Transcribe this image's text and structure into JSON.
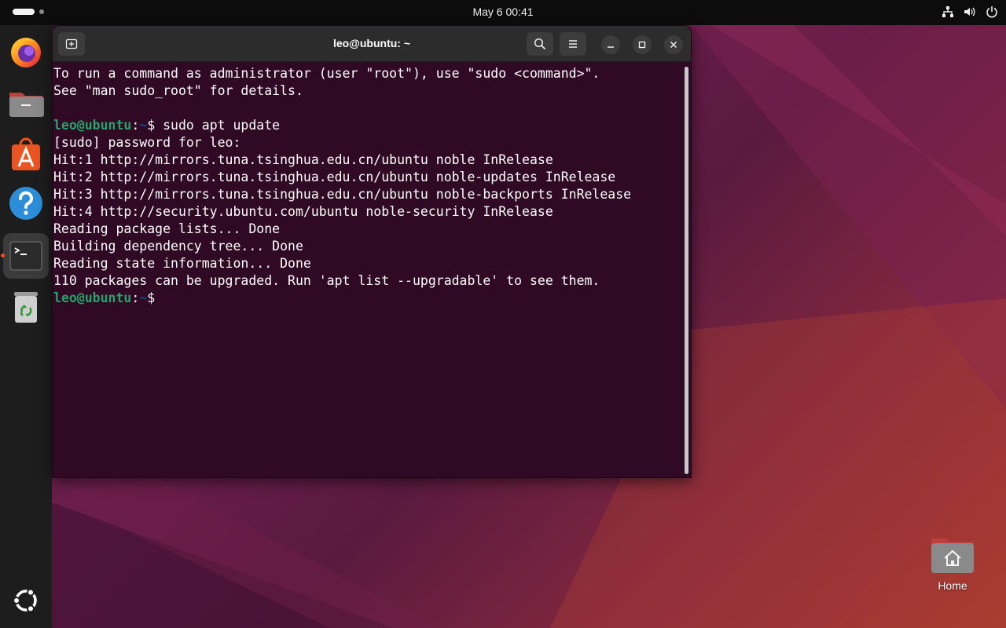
{
  "topbar": {
    "clock": "May 6  00:41",
    "tray_icons": [
      "network-icon",
      "volume-icon",
      "power-icon"
    ]
  },
  "dock": {
    "items": [
      {
        "name": "firefox",
        "icon": "firefox-icon"
      },
      {
        "name": "files",
        "icon": "folder-icon"
      },
      {
        "name": "app-center",
        "icon": "app-center-icon"
      },
      {
        "name": "help",
        "icon": "help-icon"
      },
      {
        "name": "terminal",
        "icon": "terminal-icon",
        "active": true
      },
      {
        "name": "trash",
        "icon": "trash-icon"
      },
      {
        "name": "show-apps",
        "icon": "ubuntu-logo-icon"
      }
    ]
  },
  "terminal": {
    "title": "leo@ubuntu: ~",
    "prompt": {
      "user": "leo@ubuntu",
      "colon": ":",
      "path": "~",
      "symbol": "$"
    },
    "lines": [
      "To run a command as administrator (user \"root\"), use \"sudo <command>\".",
      "See \"man sudo_root\" for details.",
      "",
      "sudo apt update",
      "[sudo] password for leo:",
      "Hit:1 http://mirrors.tuna.tsinghua.edu.cn/ubuntu noble InRelease",
      "Hit:2 http://mirrors.tuna.tsinghua.edu.cn/ubuntu noble-updates InRelease",
      "Hit:3 http://mirrors.tuna.tsinghua.edu.cn/ubuntu noble-backports InRelease",
      "Hit:4 http://security.ubuntu.com/ubuntu noble-security InRelease",
      "Reading package lists... Done",
      "Building dependency tree... Done",
      "Reading state information... Done",
      "110 packages can be upgraded. Run 'apt list --upgradable' to see them.",
      ""
    ]
  },
  "desktop": {
    "home_label": "Home"
  },
  "colors": {
    "terminal_bg": "#300a24",
    "prompt_user": "#26a269",
    "prompt_path": "#12488b",
    "accent": "#e95420"
  }
}
